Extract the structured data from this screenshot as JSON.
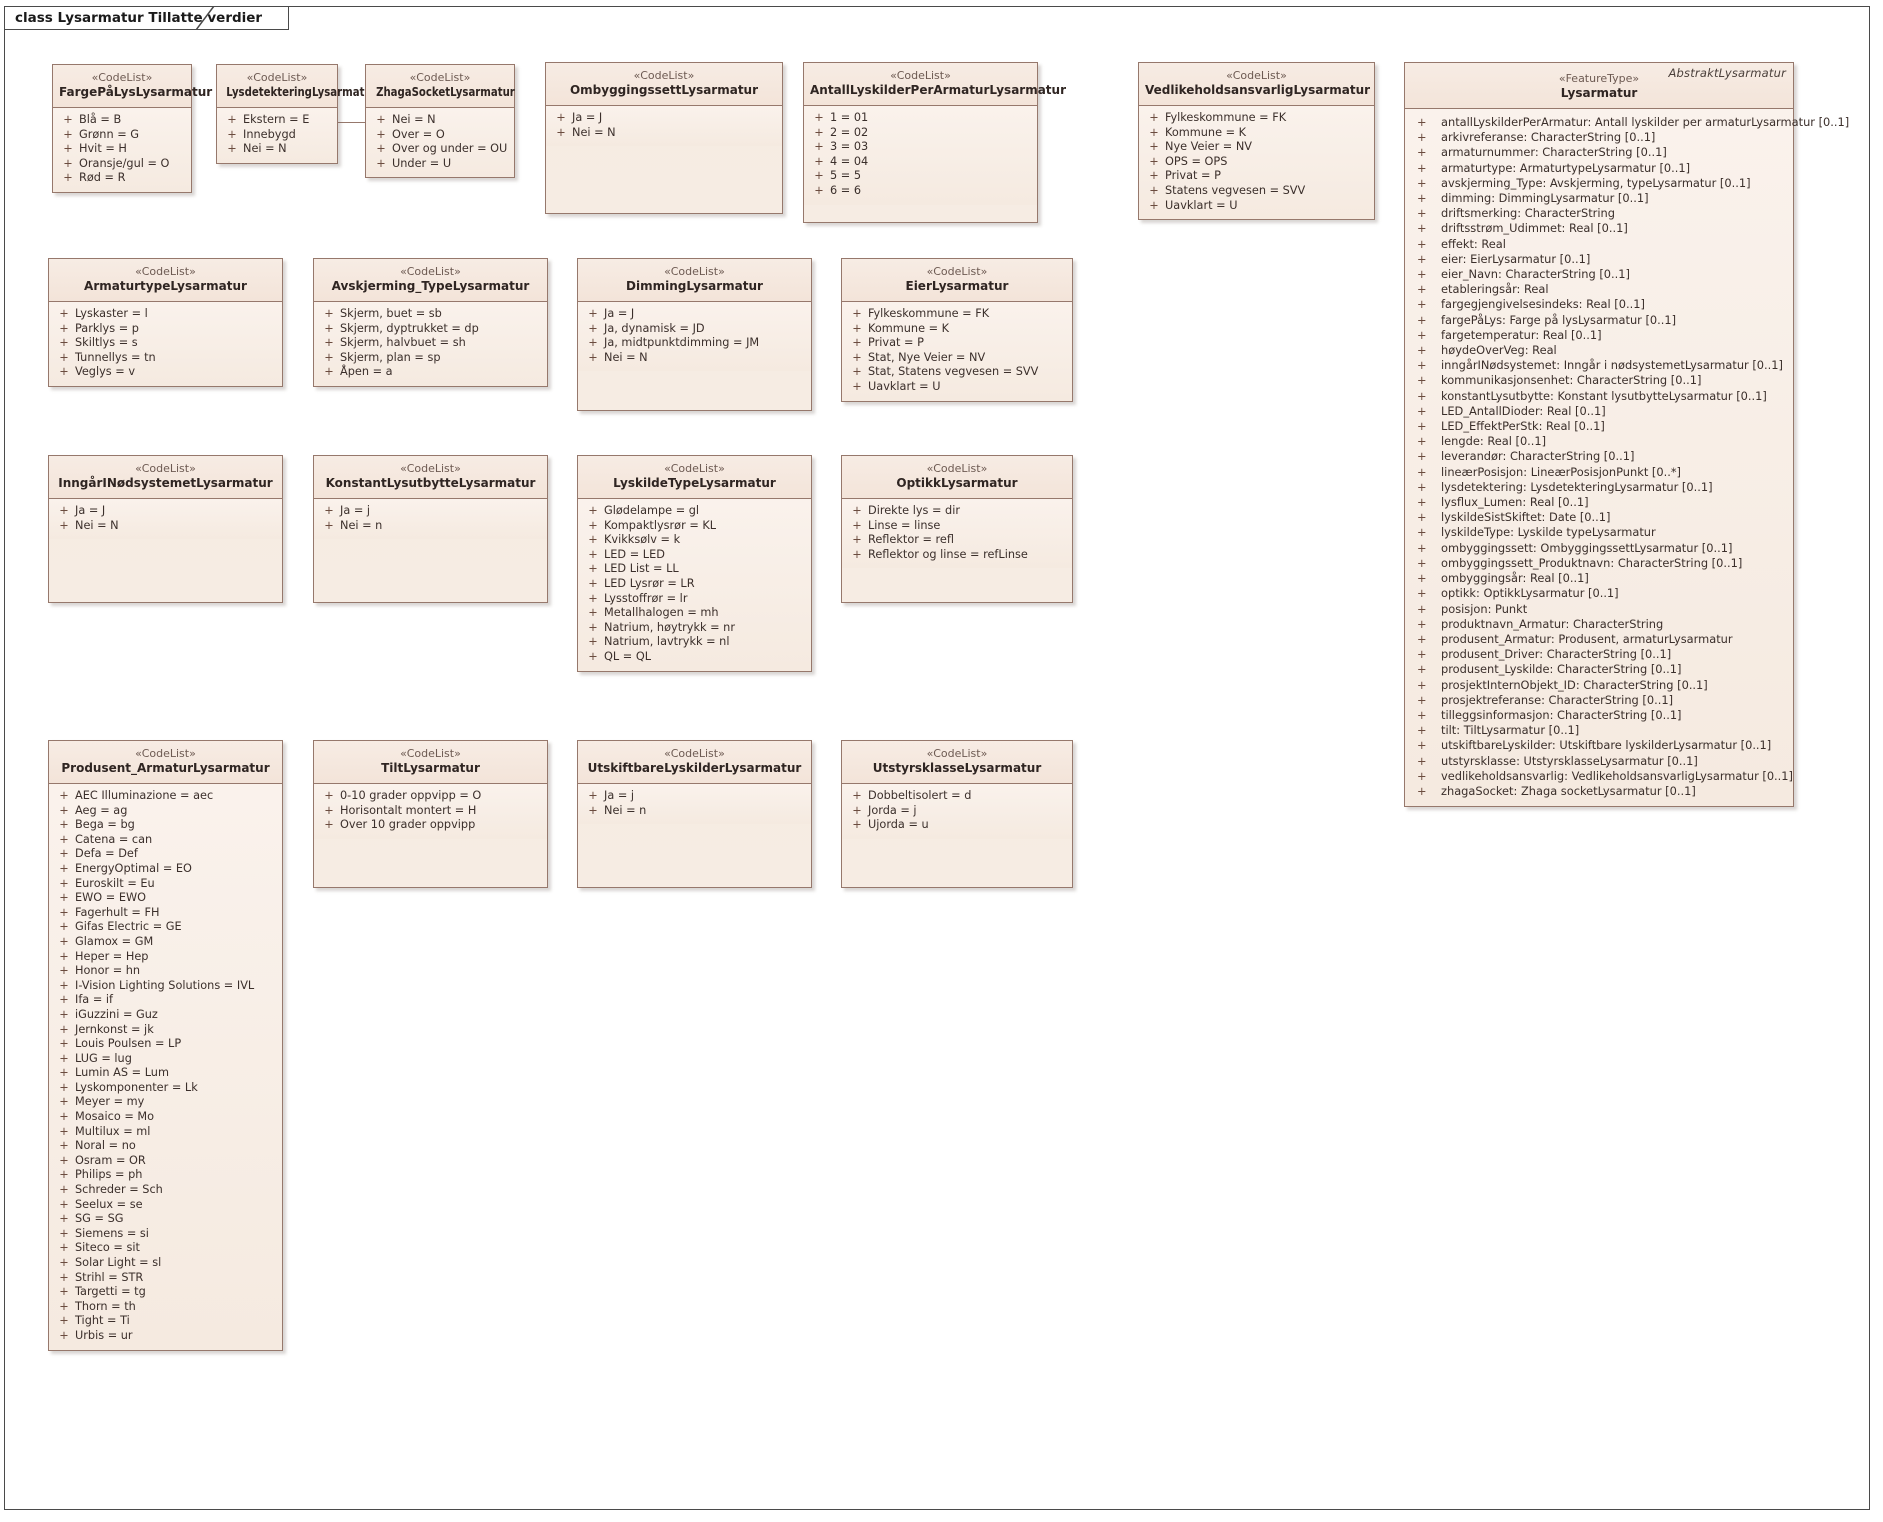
{
  "diagram": {
    "tab_label": "class Lysarmatur Tillatte verdier",
    "stereotype_codelist": "«CodeList»",
    "stereotype_featuretype": "«FeatureType»",
    "visibility_public": "+",
    "colors": {
      "border": "#96786c",
      "header_fill": "#f4e6db",
      "body_fill": "#f8efe7",
      "text": "#3b2f2b",
      "frame": "#4a4a4a"
    }
  },
  "classes": [
    {
      "id": "fargePaaLys",
      "name": "FargePåLysLysarmatur",
      "stereotype": "«CodeList»",
      "attributes": [
        "Blå = B",
        "Grønn = G",
        "Hvit = H",
        "Oransje/gul = O",
        "Rød = R"
      ]
    },
    {
      "id": "lysdetektering",
      "name": "LysdetekteringLysarmatur",
      "stereotype": "«CodeList»",
      "attributes": [
        "Ekstern = E",
        "Innebygd",
        "Nei = N"
      ]
    },
    {
      "id": "zhagaSocket",
      "name": "ZhagaSocketLysarmatur",
      "stereotype": "«CodeList»",
      "attributes": [
        "Nei = N",
        "Over = O",
        "Over og under = OU",
        "Under = U"
      ]
    },
    {
      "id": "ombyggingssett",
      "name": "OmbyggingssettLysarmatur",
      "stereotype": "«CodeList»",
      "attributes": [
        "Ja = J",
        "Nei = N"
      ]
    },
    {
      "id": "antallLyskilder",
      "name": "AntallLyskilderPerArmaturLysarmatur",
      "stereotype": "«CodeList»",
      "attributes": [
        "1 = 01",
        "2 = 02",
        "3 = 03",
        "4 = 04",
        "5 = 5",
        "6 = 6"
      ]
    },
    {
      "id": "vedlikehold",
      "name": "VedlikeholdsansvarligLysarmatur",
      "stereotype": "«CodeList»",
      "attributes": [
        "Fylkeskommune = FK",
        "Kommune = K",
        "Nye Veier = NV",
        "OPS = OPS",
        "Privat = P",
        "Statens vegvesen = SVV",
        "Uavklart = U"
      ]
    },
    {
      "id": "armaturtype",
      "name": "ArmaturtypeLysarmatur",
      "stereotype": "«CodeList»",
      "attributes": [
        "Lyskaster = l",
        "Parklys = p",
        "Skiltlys = s",
        "Tunnellys = tn",
        "Veglys = v"
      ]
    },
    {
      "id": "avskjerming",
      "name": "Avskjerming_TypeLysarmatur",
      "stereotype": "«CodeList»",
      "attributes": [
        "Skjerm, buet = sb",
        "Skjerm, dyptrukket = dp",
        "Skjerm, halvbuet = sh",
        "Skjerm, plan = sp",
        "Åpen = a"
      ]
    },
    {
      "id": "dimming",
      "name": "DimmingLysarmatur",
      "stereotype": "«CodeList»",
      "attributes": [
        "Ja = J",
        "Ja, dynamisk = JD",
        "Ja, midtpunktdimming = JM",
        "Nei = N"
      ]
    },
    {
      "id": "eier",
      "name": "EierLysarmatur",
      "stereotype": "«CodeList»",
      "attributes": [
        "Fylkeskommune = FK",
        "Kommune = K",
        "Privat = P",
        "Stat, Nye Veier = NV",
        "Stat, Statens vegvesen = SVV",
        "Uavklart = U"
      ]
    },
    {
      "id": "inngaarINoed",
      "name": "InngårINødsystemetLysarmatur",
      "stereotype": "«CodeList»",
      "attributes": [
        "Ja = J",
        "Nei = N"
      ]
    },
    {
      "id": "konstantLysutbytte",
      "name": "KonstantLysutbytteLysarmatur",
      "stereotype": "«CodeList»",
      "attributes": [
        "Ja = j",
        "Nei = n"
      ]
    },
    {
      "id": "lyskildeType",
      "name": "LyskildeTypeLysarmatur",
      "stereotype": "«CodeList»",
      "attributes": [
        "Glødelampe = gl",
        "Kompaktlysrør = KL",
        "Kvikksølv = k",
        "LED = LED",
        "LED List = LL",
        "LED Lysrør = LR",
        "Lysstoffrør = lr",
        "Metallhalogen = mh",
        "Natrium, høytrykk = nr",
        "Natrium, lavtrykk = nl",
        "QL = QL"
      ]
    },
    {
      "id": "optikk",
      "name": "OptikkLysarmatur",
      "stereotype": "«CodeList»",
      "attributes": [
        "Direkte lys = dir",
        "Linse = linse",
        "Reflektor = refl",
        "Reflektor og linse = refLinse"
      ]
    },
    {
      "id": "produsentArmatur",
      "name": "Produsent_ArmaturLysarmatur",
      "stereotype": "«CodeList»",
      "attributes": [
        "AEC Illuminazione = aec",
        "Aeg = ag",
        "Bega = bg",
        "Catena = can",
        "Defa = Def",
        "EnergyOptimal = EO",
        "Euroskilt = Eu",
        "EWO = EWO",
        "Fagerhult = FH",
        "Gifas Electric = GE",
        "Glamox = GM",
        "Heper = Hep",
        "Honor = hn",
        "I-Vision Lighting Solutions = IVL",
        "Ifa = if",
        "iGuzzini = Guz",
        "Jernkonst = jk",
        "Louis Poulsen = LP",
        "LUG = lug",
        "Lumin AS = Lum",
        "Lyskomponenter = Lk",
        "Meyer = my",
        "Mosaico = Mo",
        "Multilux = ml",
        "Noral = no",
        "Osram = OR",
        "Philips = ph",
        "Schreder = Sch",
        "Seelux = se",
        "SG = SG",
        "Siemens = si",
        "Siteco = sit",
        "Solar Light = sl",
        "Strihl = STR",
        "Targetti = tg",
        "Thorn = th",
        "Tight = Ti",
        "Urbis = ur"
      ]
    },
    {
      "id": "tilt",
      "name": "TiltLysarmatur",
      "stereotype": "«CodeList»",
      "attributes": [
        "0-10 grader oppvipp = O",
        "Horisontalt montert = H",
        "Over 10 grader oppvipp"
      ]
    },
    {
      "id": "utskiftbare",
      "name": "UtskiftbareLyskilderLysarmatur",
      "stereotype": "«CodeList»",
      "attributes": [
        "Ja = j",
        "Nei = n"
      ]
    },
    {
      "id": "utstyrsklasse",
      "name": "UtstyrsklasseLysarmatur",
      "stereotype": "«CodeList»",
      "attributes": [
        "Dobbeltisolert = d",
        "Jorda = j",
        "Ujorda = u"
      ]
    }
  ],
  "feature_class": {
    "id": "lysarmatur",
    "abstract_label": "AbstraktLysarmatur",
    "stereotype": "«FeatureType»",
    "name": "Lysarmatur",
    "attributes": [
      "antallLyskilderPerArmatur: Antall lyskilder per armaturLysarmatur [0..1]",
      "arkivreferanse: CharacterString [0..1]",
      "armaturnummer: CharacterString [0..1]",
      "armaturtype: ArmaturtypeLysarmatur [0..1]",
      "avskjerming_Type: Avskjerming, typeLysarmatur [0..1]",
      "dimming: DimmingLysarmatur [0..1]",
      "driftsmerking: CharacterString",
      "driftsstrøm_Udimmet: Real [0..1]",
      "effekt: Real",
      "eier: EierLysarmatur [0..1]",
      "eier_Navn: CharacterString [0..1]",
      "etableringsår: Real",
      "fargegjengivelsesindeks: Real [0..1]",
      "fargePåLys: Farge på lysLysarmatur [0..1]",
      "fargetemperatur: Real [0..1]",
      "høydeOverVeg: Real",
      "inngårINødsystemet: Inngår i nødsystemetLysarmatur [0..1]",
      "kommunikasjonsenhet: CharacterString [0..1]",
      "konstantLysutbytte: Konstant lysutbytteLysarmatur [0..1]",
      "LED_AntallDioder: Real [0..1]",
      "LED_EffektPerStk: Real [0..1]",
      "lengde: Real [0..1]",
      "leverandør: CharacterString [0..1]",
      "lineærPosisjon: LineærPosisjonPunkt [0..*]",
      "lysdetektering: LysdetekteringLysarmatur [0..1]",
      "lysflux_Lumen: Real [0..1]",
      "lyskildeSistSkiftet: Date [0..1]",
      "lyskildeType: Lyskilde typeLysarmatur",
      "ombyggingssett: OmbyggingssettLysarmatur [0..1]",
      "ombyggingssett_Produktnavn: CharacterString [0..1]",
      "ombyggingsår: Real [0..1]",
      "optikk: OptikkLysarmatur [0..1]",
      "posisjon: Punkt",
      "produktnavn_Armatur: CharacterString",
      "produsent_Armatur: Produsent, armaturLysarmatur",
      "produsent_Driver: CharacterString [0..1]",
      "produsent_Lyskilde: CharacterString [0..1]",
      "prosjektInternObjekt_ID: CharacterString [0..1]",
      "prosjektreferanse: CharacterString [0..1]",
      "tilleggsinformasjon: CharacterString [0..1]",
      "tilt: TiltLysarmatur [0..1]",
      "utskiftbareLyskilder: Utskiftbare lyskilderLysarmatur [0..1]",
      "utstyrsklasse: UtstyrsklasseLysarmatur [0..1]",
      "vedlikeholdsansvarlig: VedlikeholdsansvarligLysarmatur [0..1]",
      "zhagaSocket: Zhaga socketLysarmatur [0..1]"
    ]
  }
}
